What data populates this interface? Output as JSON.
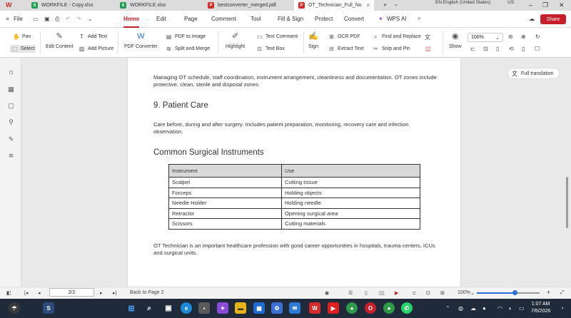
{
  "tabs": [
    {
      "label": "WORKFILE - Copy.xlsx",
      "icon_color": "#1f9d55",
      "icon_letter": "S"
    },
    {
      "label": "WORKFILE.xlsx",
      "icon_color": "#1f9d55",
      "icon_letter": "S"
    },
    {
      "label": "bestconverter_merged.pdf",
      "icon_color": "#d42a2a",
      "icon_letter": "P"
    },
    {
      "label": "OT_Technician_Full_No",
      "icon_color": "#d42a2a",
      "icon_letter": "P"
    }
  ],
  "window": {
    "lang_indicator": "EN English (United States)",
    "region": "US"
  },
  "menu": {
    "file": "File",
    "items": [
      "Home",
      "Edit",
      "Page",
      "Comment",
      "Tool",
      "Fill & Sign",
      "Protect",
      "Convert",
      "WPS AI"
    ],
    "active": "Home",
    "share": "Share"
  },
  "toolbar": {
    "pan": "Pan",
    "select": "Select",
    "edit_content": "Edit Content",
    "add_text": "Add Text",
    "add_picture": "Add Picture",
    "pdf_converter": "PDF Converter",
    "pdf_to_image": "PDF to Image",
    "split_merge": "Split and Merge",
    "highlight": "Highlight",
    "text_comment": "Text Comment",
    "text_box": "Text Box",
    "sign": "Sign",
    "ocr_pdf": "OCR PDF",
    "extract_text": "Extract Text",
    "find_replace": "Find and Replace",
    "snip_pin": "Snip and Pin",
    "show": "Show",
    "zoom": "100%"
  },
  "side_panel": {
    "full_translation": "Full translation"
  },
  "document": {
    "para_intro": "Managing OT schedule, staff coordination, instrument arrangement, cleanliness and documentation. OT zones include protective, clean, sterile and disposal zones.",
    "heading_patient_care": "9. Patient Care",
    "para_patient_care": "Care before, during and after surgery. Includes patient preparation, monitoring, recovery care and infection observation.",
    "heading_instruments": "Common Surgical Instruments",
    "table": {
      "headers": [
        "Instrument",
        "Use"
      ],
      "rows": [
        [
          "Scalpel",
          "Cutting tissue"
        ],
        [
          "Forceps",
          "Holding objects"
        ],
        [
          "Needle Holder",
          "Holding needle"
        ],
        [
          "Retractor",
          "Opening surgical area"
        ],
        [
          "Scissors",
          "Cutting materials"
        ]
      ]
    },
    "para_outro": "OT Technician is an important healthcare profession with good career opportunities in hospitals, trauma centers, ICUs and surgical units."
  },
  "status": {
    "page_indicator": "2/2",
    "back_to_page": "Back to Page 2",
    "zoom": "100%",
    "zoom_fraction": 0.6
  },
  "clock": {
    "time": "1:07 AM",
    "date": "7/6/2026"
  },
  "colors": {
    "accent": "#c8202a",
    "taskbar": "#1f2b3a"
  }
}
